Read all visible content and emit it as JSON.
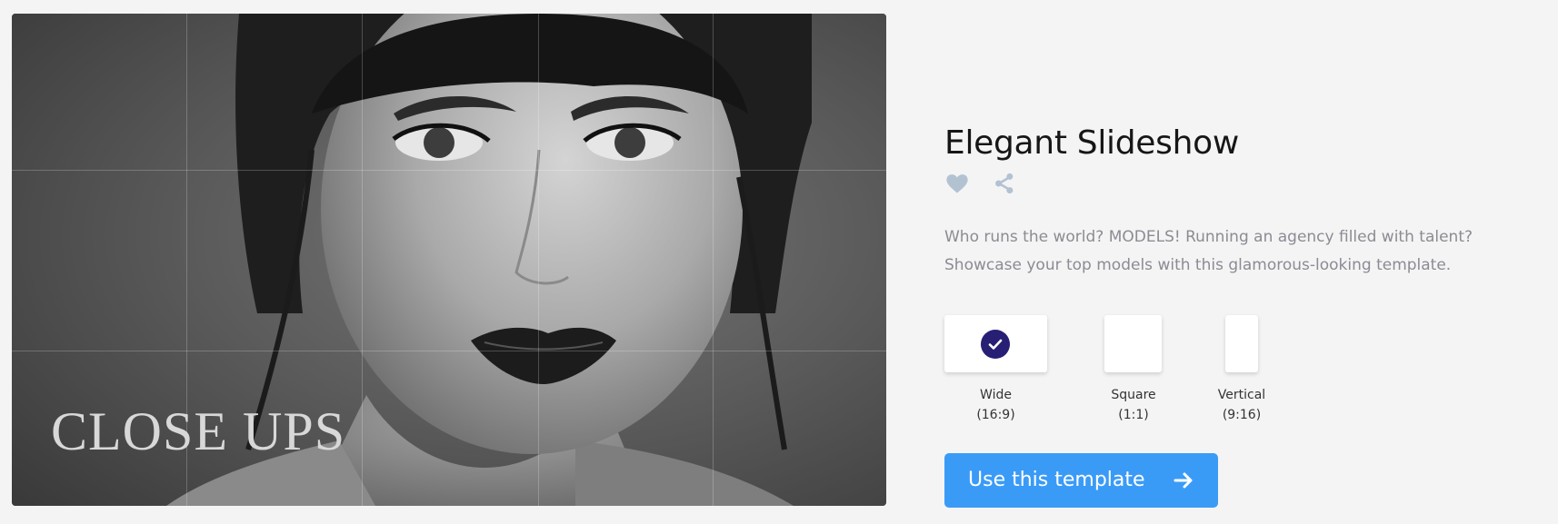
{
  "preview": {
    "overlay_text": "CLOSE UPS"
  },
  "template": {
    "title": "Elegant Slideshow",
    "description_lines": [
      "Who runs the world? MODELS! Running an agency filled with talent?",
      "Showcase your top models with this glamorous-looking template."
    ]
  },
  "actions": {
    "favorite_icon": "heart-icon",
    "share_icon": "share-icon",
    "icon_color": "#b3c2d1"
  },
  "formats": [
    {
      "name": "Wide",
      "ratio": "(16:9)",
      "selected": true
    },
    {
      "name": "Square",
      "ratio": "(1:1)",
      "selected": false
    },
    {
      "name": "Vertical",
      "ratio": "(9:16)",
      "selected": false
    }
  ],
  "cta": {
    "label": "Use this template",
    "icon": "arrow-right-icon",
    "color": "#3a9bf7"
  },
  "colors": {
    "background": "#f4f4f5",
    "selected_badge": "#271f74",
    "description_text": "#8b8b93"
  }
}
